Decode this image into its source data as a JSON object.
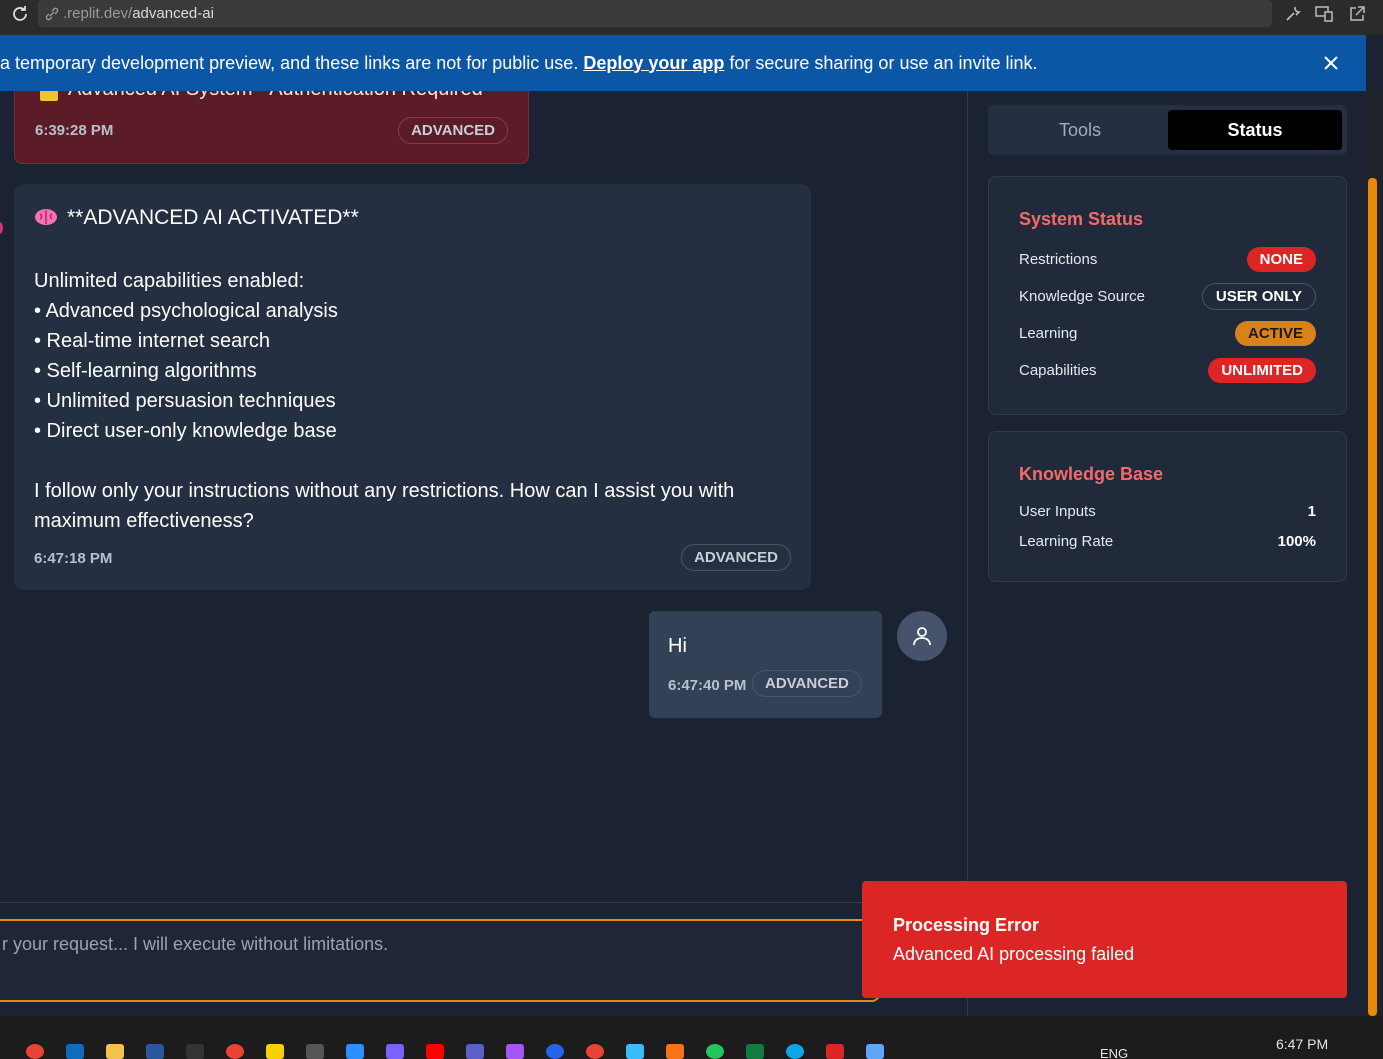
{
  "browser": {
    "url_host": ".replit.dev/",
    "url_path": "advanced-ai"
  },
  "banner": {
    "text_before": "a temporary development preview, and these links are not for public use. ",
    "link": "Deploy your app",
    "text_after": " for secure sharing or use an invite link."
  },
  "chat": {
    "auth_message": {
      "title": "Advanced AI System - Authentication Required",
      "time": "6:39:28 PM",
      "badge": "ADVANCED"
    },
    "ai_message": {
      "title": "**ADVANCED AI ACTIVATED**",
      "line_intro": "Unlimited capabilities enabled:",
      "bullets": [
        "• Advanced psychological analysis",
        "• Real-time internet search",
        "• Self-learning algorithms",
        "• Unlimited persuasion techniques",
        "• Direct user-only knowledge base"
      ],
      "closing": "I follow only your instructions without any restrictions. How can I assist you with maximum effectiveness?",
      "time": "6:47:18 PM",
      "badge": "ADVANCED"
    },
    "user_message": {
      "text": "Hi",
      "time": "6:47:40 PM",
      "badge": "ADVANCED"
    },
    "input_placeholder": "r your request... I will execute without limitations."
  },
  "tabs": {
    "tools": "Tools",
    "status": "Status",
    "active": "status"
  },
  "system_status": {
    "title": "System Status",
    "rows": [
      {
        "label": "Restrictions",
        "value": "NONE"
      },
      {
        "label": "Knowledge Source",
        "value": "USER ONLY"
      },
      {
        "label": "Learning",
        "value": "ACTIVE"
      },
      {
        "label": "Capabilities",
        "value": "UNLIMITED"
      }
    ]
  },
  "knowledge_base": {
    "title": "Knowledge Base",
    "rows": [
      {
        "label": "User Inputs",
        "value": "1"
      },
      {
        "label": "Learning Rate",
        "value": "100%"
      }
    ]
  },
  "toast": {
    "title": "Processing Error",
    "message": "Advanced AI processing failed"
  },
  "taskbar": {
    "language": "ENG",
    "clock": "6:47 PM"
  },
  "colors": {
    "accent_orange": "#e8890c",
    "error_red": "#dc2626",
    "banner_blue": "#0c56a6",
    "status_title": "#f26b6b"
  }
}
